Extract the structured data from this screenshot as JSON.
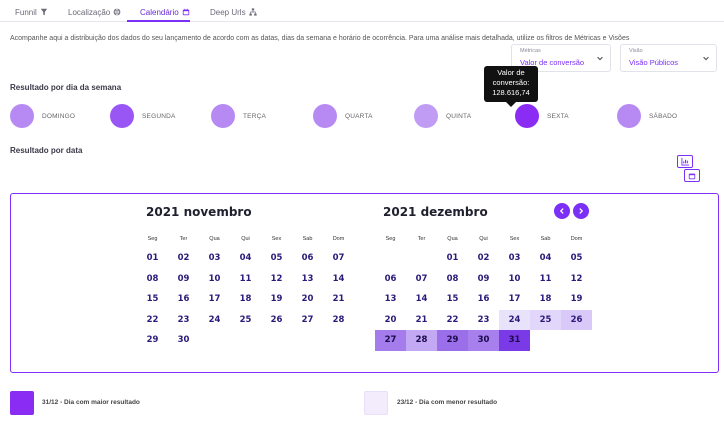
{
  "tabs": [
    {
      "label": "Funnil",
      "icon": "filter-icon"
    },
    {
      "label": "Localização",
      "icon": "globe-icon"
    },
    {
      "label": "Calendário",
      "icon": "calendar-icon"
    },
    {
      "label": "Deep Urls",
      "icon": "sitemap-icon"
    }
  ],
  "description": "Acompanhe aqui a distribuição dos dados do seu lançamento de acordo com as datas, dias da semana e horário de ocorrência. Para uma análise mais detalhada, utilize os filtros de Métricas e Visões",
  "filters": {
    "metricas": {
      "label": "Métricas",
      "value": "Valor de conversão"
    },
    "visao": {
      "label": "Visão",
      "value": "Visão Públicos"
    }
  },
  "weekday_section": {
    "title": "Resultado por dia da semana",
    "days": [
      {
        "label": "DOMINGO",
        "color": "#b78af3"
      },
      {
        "label": "SEGUNDA",
        "color": "#9a55f5"
      },
      {
        "label": "TERÇA",
        "color": "#b78af3"
      },
      {
        "label": "QUARTA",
        "color": "#b78af3"
      },
      {
        "label": "QUINTA",
        "color": "#c19cf5"
      },
      {
        "label": "SEXTA",
        "color": "#8b2cf5"
      },
      {
        "label": "SÁBADO",
        "color": "#b78af3"
      }
    ]
  },
  "tooltip": {
    "line1": "Valor de",
    "line2": "conversão:",
    "value": "128.616,74"
  },
  "date_section": {
    "title": "Resultado por data"
  },
  "calendar": {
    "weekday_headers": [
      "Seg",
      "Ter",
      "Qua",
      "Qui",
      "Sex",
      "Sab",
      "Dom"
    ],
    "months": [
      {
        "title": "2021 novembro",
        "weeks": [
          [
            "01",
            "02",
            "03",
            "04",
            "05",
            "06",
            "07"
          ],
          [
            "08",
            "09",
            "10",
            "11",
            "12",
            "13",
            "14"
          ],
          [
            "15",
            "16",
            "17",
            "18",
            "19",
            "20",
            "21"
          ],
          [
            "22",
            "23",
            "24",
            "25",
            "26",
            "27",
            "28"
          ],
          [
            "29",
            "30",
            "",
            "",
            "",
            "",
            ""
          ]
        ]
      },
      {
        "title": "2021 dezembro",
        "weeks": [
          [
            "",
            "",
            "01",
            "02",
            "03",
            "04",
            "05"
          ],
          [
            "06",
            "07",
            "08",
            "09",
            "10",
            "11",
            "12"
          ],
          [
            "13",
            "14",
            "15",
            "16",
            "17",
            "18",
            "19"
          ],
          [
            "20",
            "21",
            "22",
            "23",
            "24",
            "25",
            "26"
          ],
          [
            "27",
            "28",
            "29",
            "30",
            "31",
            "",
            ""
          ]
        ],
        "highlights": {
          "24": "#e9e2fb",
          "25": "#e2d7fb",
          "26": "#d8c9f8",
          "27": "#a47cec",
          "28": "#c3a9f3",
          "29": "#9c6fea",
          "30": "#a880ee",
          "31": "#7a3be6"
        }
      }
    ]
  },
  "legend": {
    "max": {
      "text": "31/12 - Dia com maior resultado",
      "color": "#8b2cf5"
    },
    "min": {
      "text": "23/12 - Dia com menor resultado",
      "color": "#f2ecfd"
    }
  }
}
